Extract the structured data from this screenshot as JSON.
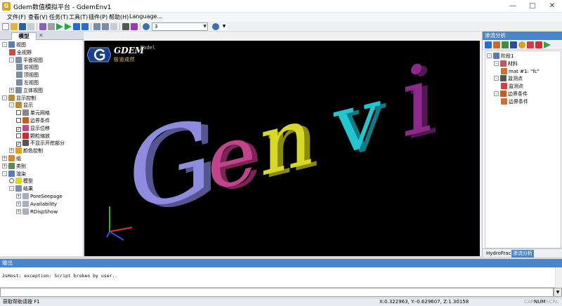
{
  "window": {
    "title": "Gdem数值模拟平台 - GdemEnv1",
    "app_icon": "G",
    "controls": [
      "minimize-icon",
      "maximize-icon",
      "close-icon"
    ]
  },
  "menu": [
    "文件(F)",
    "查看(V)",
    "任务(T)",
    "工具(T)",
    "插件(P)",
    "帮助(H)",
    "Language..."
  ],
  "toolbar": {
    "combo_value": "3",
    "combo2_value": ""
  },
  "left_panel": {
    "tab_label": "模型",
    "tree": [
      {
        "label": "视图",
        "icon": "magnifier-icon",
        "depth": 0,
        "expander": "-"
      },
      {
        "label": "全视野",
        "icon": "zoom-extents-icon",
        "depth": 1
      },
      {
        "label": "平面视图",
        "icon": "plane-view-icon",
        "depth": 1,
        "expander": "-"
      },
      {
        "label": "前视图",
        "icon": "front-view-icon",
        "depth": 2
      },
      {
        "label": "顶视图",
        "icon": "top-view-icon",
        "depth": 2
      },
      {
        "label": "左视图",
        "icon": "left-view-icon",
        "depth": 2
      },
      {
        "label": "立体视图",
        "icon": "3d-view-icon",
        "depth": 1,
        "expander": "+"
      },
      {
        "label": "显示控制",
        "icon": "eye-icon",
        "depth": 0,
        "expander": "-"
      },
      {
        "label": "显示",
        "icon": "eye-icon",
        "depth": 1,
        "expander": "-"
      },
      {
        "label": "单元网格",
        "icon": "mesh-icon",
        "depth": 2,
        "checkbox": false
      },
      {
        "label": "边界条件",
        "icon": "boundary-icon",
        "depth": 2,
        "checkbox": false
      },
      {
        "label": "显示位移",
        "icon": "displacement-icon",
        "depth": 2,
        "checkbox": true
      },
      {
        "label": "颗粒缩放",
        "icon": "particle-scale-icon",
        "depth": 2,
        "checkbox": false
      },
      {
        "label": "不显示开挖部分",
        "icon": "excavation-icon",
        "depth": 2,
        "checkbox": true
      },
      {
        "label": "颜色控制",
        "icon": "color-control-icon",
        "depth": 1,
        "expander": "+"
      },
      {
        "label": "组",
        "icon": "group-icon",
        "depth": 0,
        "expander": "+"
      },
      {
        "label": "类别",
        "icon": "category-icon",
        "depth": 0,
        "expander": "+"
      },
      {
        "label": "渲染",
        "icon": "render-icon",
        "depth": 0,
        "expander": "-"
      },
      {
        "label": "模型",
        "icon": "model-sphere-icon",
        "depth": 1,
        "radio": true
      },
      {
        "label": "结果",
        "icon": "results-icon",
        "depth": 1,
        "expander": "-"
      },
      {
        "label": "PoreSeepage",
        "icon": "result-item-icon",
        "depth": 2,
        "expander": "+"
      },
      {
        "label": "Availability",
        "icon": "result-item-icon",
        "depth": 2,
        "expander": "+"
      },
      {
        "label": "RDispShow",
        "icon": "result-item-icon",
        "depth": 2,
        "expander": "+"
      }
    ]
  },
  "viewport": {
    "logo_text": "GDEM",
    "logo_sub": "极道成然",
    "logo_caption": "Model",
    "model_letters": [
      {
        "ch": "G",
        "color": "#8d8ce0"
      },
      {
        "ch": "e",
        "color": "#c2448a"
      },
      {
        "ch": "n",
        "color": "#d8d82a"
      },
      {
        "ch": "v",
        "color": "#22c6cf"
      },
      {
        "ch": "i",
        "color": "#8b2a8b"
      }
    ],
    "axes": {
      "x_color": "#e03030",
      "y_color": "#30b030",
      "z_color": "#3050e0"
    }
  },
  "right_panel": {
    "title": "渗流分析",
    "tree": [
      {
        "label": "阶段1",
        "icon": "stage-icon",
        "depth": 0,
        "expander": "-"
      },
      {
        "label": "材料",
        "icon": "material-icon",
        "depth": 1,
        "expander": "-"
      },
      {
        "label": "mat #1: \"fc\"",
        "icon": "pencil-icon",
        "depth": 2
      },
      {
        "label": "监测点",
        "icon": "monitor-icon",
        "depth": 1,
        "expander": "-"
      },
      {
        "label": "监测点",
        "icon": "monitor-point-icon",
        "depth": 2
      },
      {
        "label": "边界条件",
        "icon": "boundary-icon",
        "depth": 1,
        "expander": "-"
      },
      {
        "label": "边界条件",
        "icon": "pencil-icon",
        "depth": 2
      }
    ],
    "tabs": [
      "HydroFrac",
      "渗流分析"
    ],
    "active_tab": 1
  },
  "output": {
    "title": "输出",
    "text": "JsHost: exception: Script broken by user."
  },
  "status": {
    "help": "获取帮助请按 F1",
    "coords": "X:0.322963, Y:-0.629607, Z:1.30158",
    "cap": "CAP",
    "num": "NUM",
    "scrl": "SCRL"
  },
  "colors": {
    "accent": "#4a84c9",
    "viewport_bg": "#000000"
  }
}
